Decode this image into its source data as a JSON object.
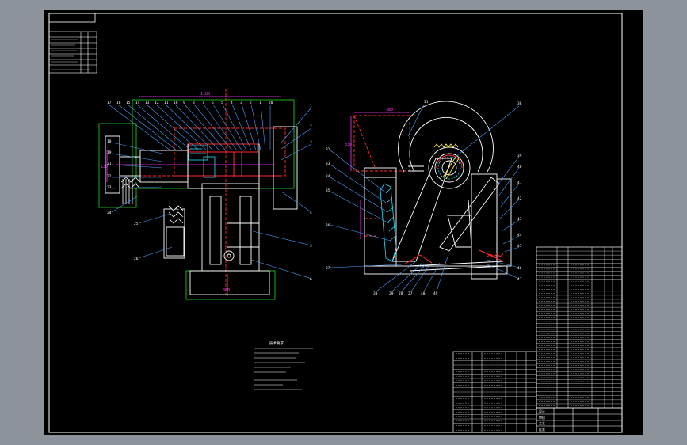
{
  "colors": {
    "page_bg": "#8c939b",
    "viewport_bg": "#000000",
    "border": "#ffffff",
    "line": "#ffffff",
    "accent_red": "#ff2a2a",
    "accent_magenta": "#ff33ff",
    "accent_green": "#22dd22",
    "accent_cyan": "#22e0ff",
    "accent_yellow": "#ffee33"
  },
  "drawing": {
    "title_block_labels": [
      "设计",
      "审核",
      "工艺",
      "批准"
    ],
    "tech_requirements_heading": "技术要求"
  }
}
